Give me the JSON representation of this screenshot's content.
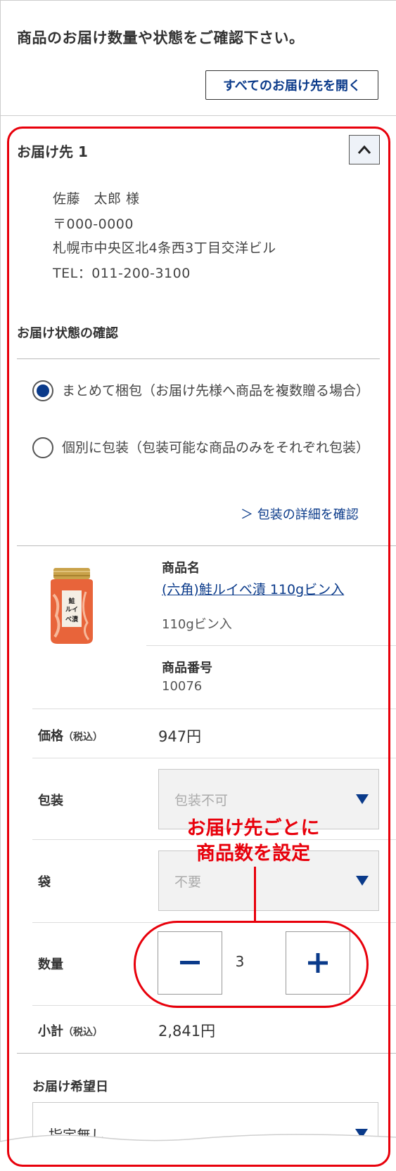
{
  "header": {
    "title": "商品のお届け数量や状態をご確認下さい。",
    "open_all_button": "すべてのお届け先を開く"
  },
  "destination": {
    "title": "お届け先 1",
    "name": "佐藤　太郎 様",
    "postal": "〒000-0000",
    "address": "札幌市中央区北4条西3丁目交洋ビル",
    "tel": "TEL：011-200-3100"
  },
  "delivery_state": {
    "heading": "お届け状態の確認",
    "options": [
      {
        "label": "まとめて梱包（お届け先様へ商品を複数贈る場合）",
        "selected": true
      },
      {
        "label": "個別に包装（包装可能な商品のみをそれぞれ包装）",
        "selected": false
      }
    ],
    "detail_link": "＞ 包装の詳細を確認"
  },
  "product": {
    "image_icon": "salmon-jar-image",
    "name_label": "商品名",
    "name_link_prefix": "(六角)",
    "name_link_rest": "鮭ルイベ漬 110gビン入",
    "variant": "110gビン入",
    "number_label": "商品番号",
    "number": "10076",
    "jar_label": "鮭ルイベ漬"
  },
  "price": {
    "label": "価格",
    "tax_note": "（税込）",
    "value": "947円"
  },
  "wrapping": {
    "label": "包装",
    "value": "包装不可"
  },
  "bag": {
    "label": "袋",
    "value": "不要"
  },
  "quantity": {
    "label": "数量",
    "value": "3",
    "minus": "−",
    "plus": "+"
  },
  "subtotal": {
    "label": "小計",
    "tax_note": "（税込）",
    "value": "2,841円"
  },
  "delivery_date": {
    "label": "お届け希望日",
    "value": "指定無し"
  },
  "callout": {
    "line1": "お届け先ごとに",
    "line2": "商品数を設定"
  },
  "colors": {
    "accent": "#0a3a8a",
    "highlight": "#e8000b",
    "border": "#cccccc"
  }
}
